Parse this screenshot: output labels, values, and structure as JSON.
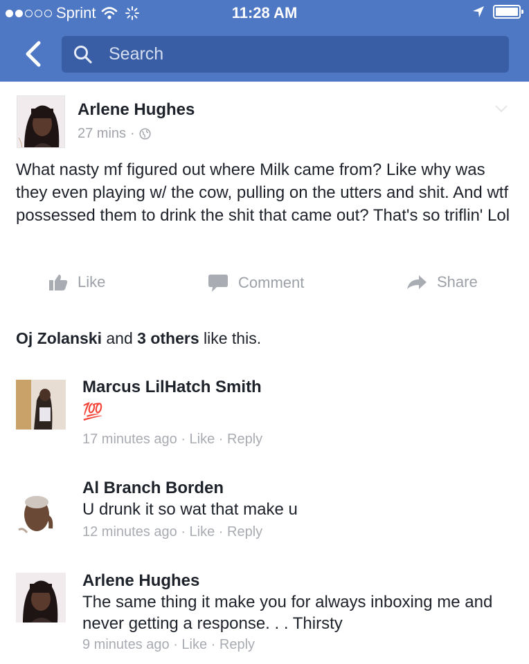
{
  "status_bar": {
    "carrier": "Sprint",
    "time": "11:28 AM"
  },
  "header": {
    "search_placeholder": "Search",
    "bg_color": "#4e78c4",
    "search_bg_color": "#3a5ea5"
  },
  "post": {
    "author": "Arlene Hughes",
    "time": "27 mins",
    "separator": "·",
    "privacy_icon": "globe-icon",
    "text": "What nasty mf figured out where Milk came from? Like why was they even playing w/ the cow, pulling on the utters and shit. And wtf possessed them to drink the shit that came out? That's so triflin' Lol",
    "actions": {
      "like": "Like",
      "comment": "Comment",
      "share": "Share"
    },
    "likes_summary": {
      "name": "Oj Zolanski",
      "and": " and ",
      "others": "3 others",
      "suffix": " like this."
    }
  },
  "comments": [
    {
      "author": "Marcus LilHatch Smith",
      "text": "💯",
      "time": "17 minutes ago",
      "like": "Like",
      "reply": "Reply"
    },
    {
      "author": "Al Branch Borden",
      "text": "U drunk it so wat that make u",
      "time": "12 minutes ago",
      "like": "Like",
      "reply": "Reply"
    },
    {
      "author": "Arlene Hughes",
      "text": "The same thing it make you for always inboxing me and never getting a response. . . Thirsty",
      "time": "9 minutes ago",
      "like": "Like",
      "reply": "Reply"
    }
  ],
  "meta_separator": " · "
}
